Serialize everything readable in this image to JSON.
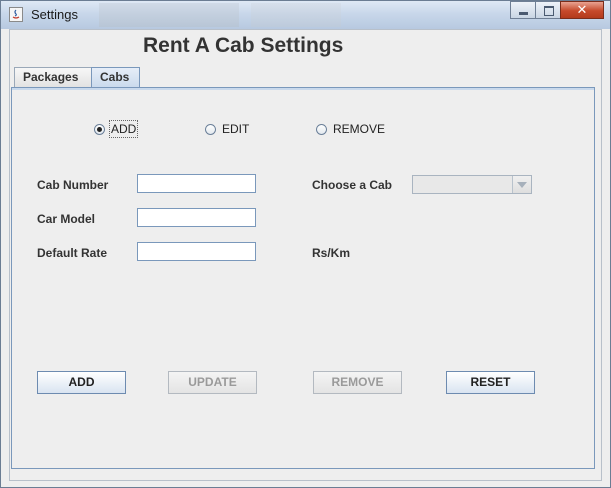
{
  "window": {
    "title": "Settings"
  },
  "heading": "Rent A Cab Settings",
  "tabs": [
    {
      "label": "Packages",
      "active": false
    },
    {
      "label": "Cabs",
      "active": true
    }
  ],
  "mode_options": [
    {
      "label": "ADD",
      "selected": true
    },
    {
      "label": "EDIT",
      "selected": false
    },
    {
      "label": "REMOVE",
      "selected": false
    }
  ],
  "form": {
    "cab_number_label": "Cab Number",
    "cab_number_value": "",
    "car_model_label": "Car Model",
    "car_model_value": "",
    "default_rate_label": "Default Rate",
    "default_rate_value": "",
    "rate_unit": "Rs/Km",
    "choose_cab_label": "Choose a Cab",
    "choose_cab_value": ""
  },
  "buttons": {
    "add": "ADD",
    "update": "UPDATE",
    "remove": "REMOVE",
    "reset": "RESET"
  }
}
